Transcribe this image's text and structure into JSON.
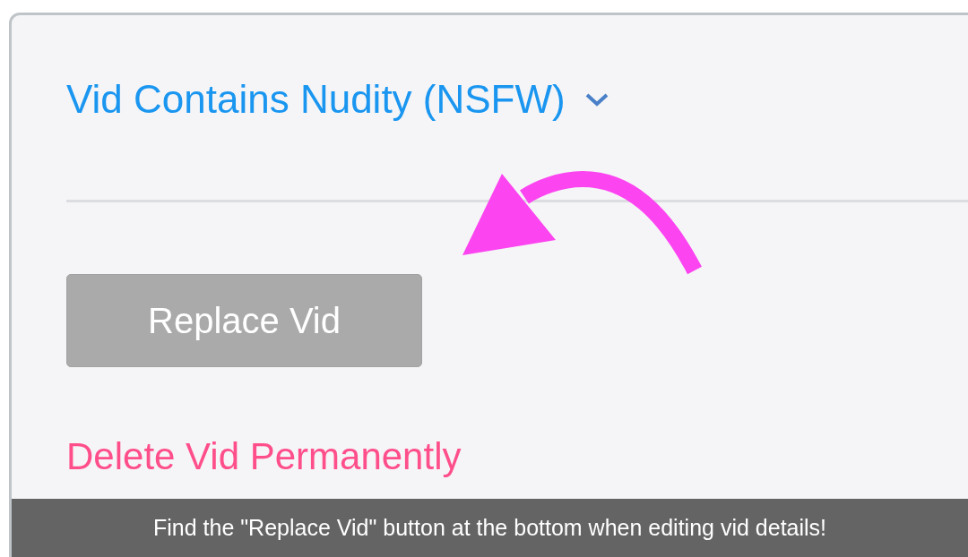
{
  "section": {
    "title": "Vid Contains Nudity (NSFW)"
  },
  "replace_button": {
    "label": "Replace Vid",
    "disabled": true
  },
  "delete_link": {
    "label": "Delete Vid Permanently"
  },
  "caption": "Find the \"Replace Vid\" button at the bottom when editing vid details!"
}
